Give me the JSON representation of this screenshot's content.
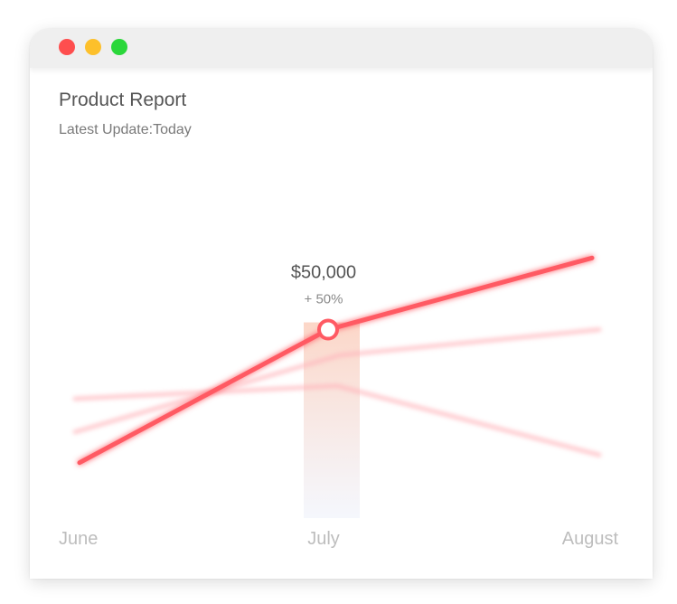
{
  "window": {
    "controls": [
      {
        "name": "close",
        "color": "#fe4e4e"
      },
      {
        "name": "minimize",
        "color": "#fdc02b"
      },
      {
        "name": "zoom",
        "color": "#2ad73a"
      }
    ]
  },
  "report": {
    "title": "Product Report",
    "subtitle_label": "Latest Update:",
    "subtitle_value": "Today"
  },
  "colors": {
    "primary_line": "#ff5a63",
    "secondary_line": "#ffb7bd",
    "highlight_top": "#fbc9b5",
    "highlight_bottom": "#eef2fb"
  },
  "chart_data": {
    "type": "line",
    "categories": [
      "June",
      "July",
      "August"
    ],
    "series": [
      {
        "role": "primary",
        "values": [
          10,
          62,
          90
        ]
      },
      {
        "role": "background",
        "values": [
          22,
          52,
          62
        ]
      },
      {
        "role": "background",
        "values": [
          35,
          40,
          13
        ]
      }
    ],
    "ylim": [
      0,
      100
    ],
    "grid": false,
    "highlight": {
      "category": "July",
      "value_label": "$50,000",
      "change_label": "+ 50%"
    }
  }
}
